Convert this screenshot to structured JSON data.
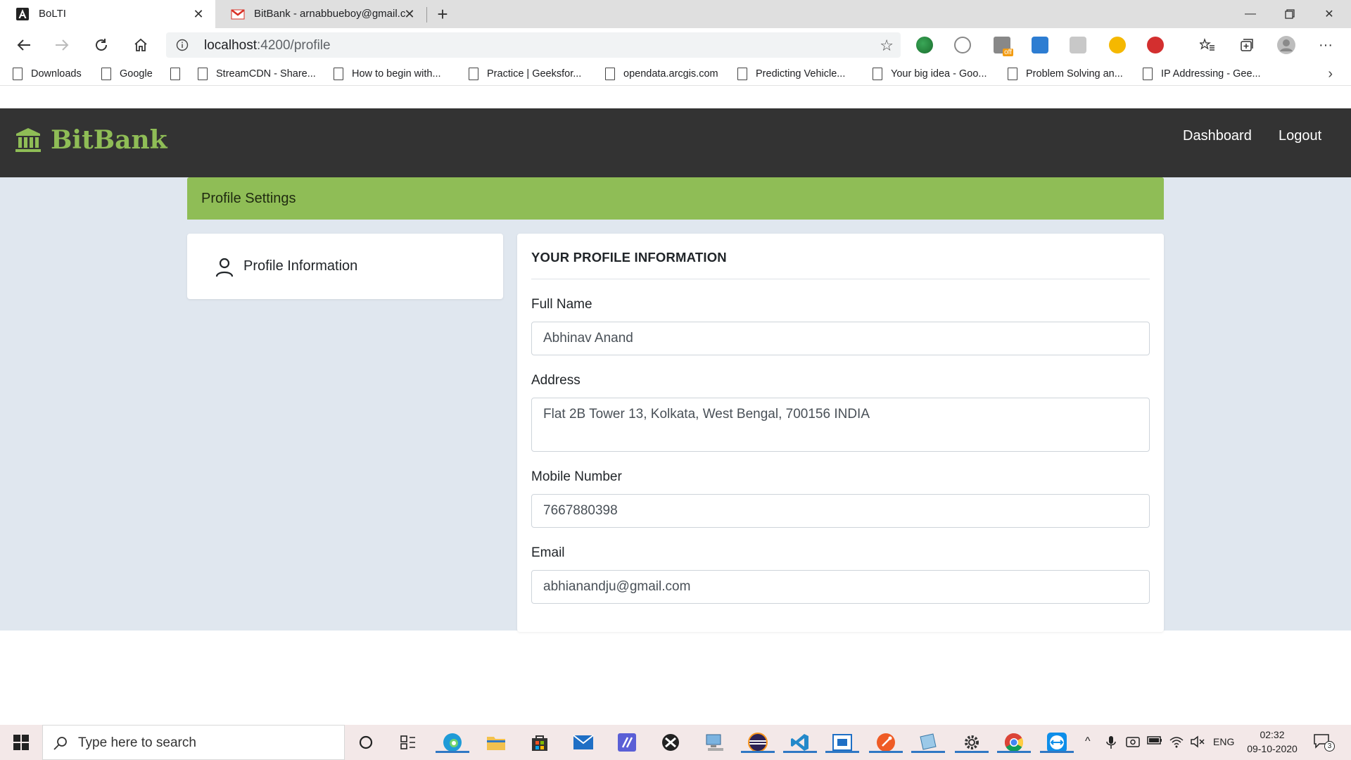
{
  "browser": {
    "tabs": [
      {
        "title": "BoLTI",
        "active": true
      },
      {
        "title": "BitBank - arnabbueboy@gmail.c",
        "active": false
      }
    ],
    "address": {
      "host": "localhost",
      "path": ":4200/profile"
    },
    "bookmarks": [
      "Downloads",
      "Google",
      "",
      "StreamCDN - Share...",
      "How to begin with...",
      "Practice | Geeksfor...",
      "opendata.arcgis.com",
      "Predicting Vehicle...",
      "Your big idea - Goo...",
      "Problem Solving an...",
      "IP Addressing - Gee..."
    ]
  },
  "app": {
    "brand": "BitBank",
    "nav": {
      "dashboard": "Dashboard",
      "logout": "Logout"
    },
    "settings_header": "Profile Settings",
    "sidebar": {
      "profile_info": "Profile Information"
    },
    "form": {
      "title": "YOUR PROFILE INFORMATION",
      "full_name": {
        "label": "Full Name",
        "value": "Abhinav Anand"
      },
      "address": {
        "label": "Address",
        "value": "Flat 2B Tower 13, Kolkata, West Bengal, 700156 INDIA"
      },
      "mobile": {
        "label": "Mobile Number",
        "value": "7667880398"
      },
      "email": {
        "label": "Email",
        "value": "abhianandju@gmail.com"
      }
    },
    "colors": {
      "accent": "#8fbd56",
      "navbar": "#333333",
      "body_bg": "#e0e7ef"
    }
  },
  "taskbar": {
    "search_placeholder": "Type here to search",
    "language": "ENG",
    "time": "02:32",
    "date": "09-10-2020",
    "notification_count": "3"
  }
}
